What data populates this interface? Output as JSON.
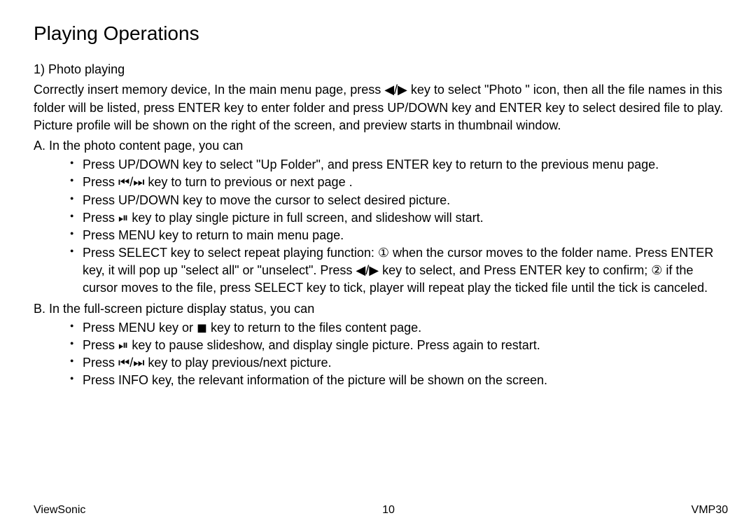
{
  "heading": "Playing Operations",
  "section1": {
    "title": "1) Photo playing",
    "intro": "Correctly insert memory device, In the main menu page, press ◀/▶ key to select \"Photo \" icon, then all the file names in this folder will be listed, press ENTER key to enter folder and press UP/DOWN key and ENTER key to select desired file to play. Picture profile will be shown on the right of the screen, and preview starts in thumbnail window.",
    "subA_label": "A. In the photo content page, you can",
    "subA_items": [
      "Press UP/DOWN key to select \"Up Folder\", and press ENTER key to return to the previous menu page.",
      "Press ⏮/⏭ key to turn to previous or next page .",
      "Press UP/DOWN key to move the cursor to select desired picture.",
      "Press ⏯ key to play single picture in full screen, and slideshow will start.",
      "Press MENU key to return to main menu page.",
      "Press SELECT key to select repeat playing function: ① when the cursor moves to the folder name. Press ENTER key, it will pop up \"select all\" or \"unselect\". Press ◀/▶ key to select, and Press ENTER key to confirm; ② if the cursor moves to the file, press SELECT key to tick, player will repeat play the ticked file until the tick is canceled."
    ],
    "subB_label": "B. In the full-screen picture display status, you can",
    "subB_items": [
      "Press MENU key or ◼ key to return to the files content page.",
      "Press ⏯ key to pause slideshow, and display single picture. Press again to restart.",
      "Press ⏮/⏭ key to play previous/next picture.",
      "Press INFO key, the relevant information of the picture will be shown on the screen."
    ]
  },
  "footer": {
    "left": "ViewSonic",
    "center": "10",
    "right": "VMP30"
  }
}
